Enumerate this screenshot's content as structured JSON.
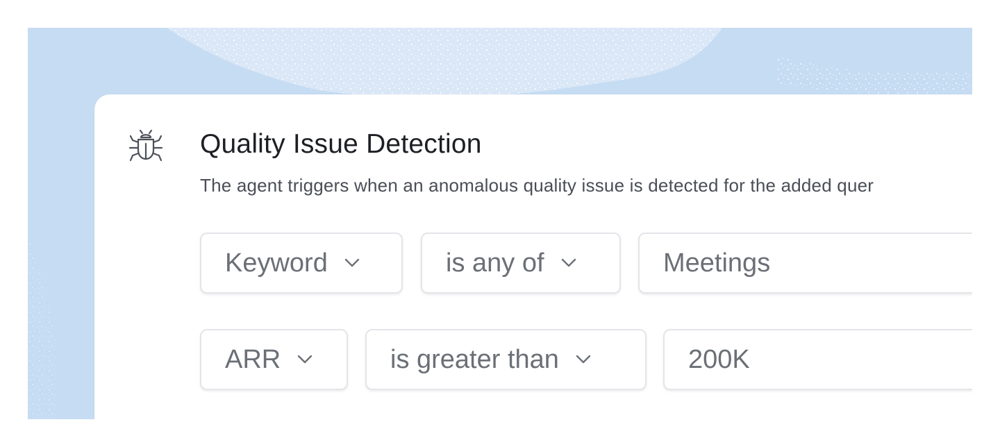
{
  "agent_card": {
    "title": "Quality Issue Detection",
    "description": "The agent triggers when an anomalous quality issue is detected for the added quer",
    "icon": "bug-icon"
  },
  "conditions": [
    {
      "field": "Keyword",
      "operator": "is any of",
      "value": "Meetings"
    },
    {
      "field": "ARR",
      "operator": "is greater than",
      "value": "200K"
    }
  ],
  "colors": {
    "background": "#c6dcf3",
    "card": "#ffffff",
    "title": "#1d1f24",
    "text_muted": "#6b6f76"
  }
}
